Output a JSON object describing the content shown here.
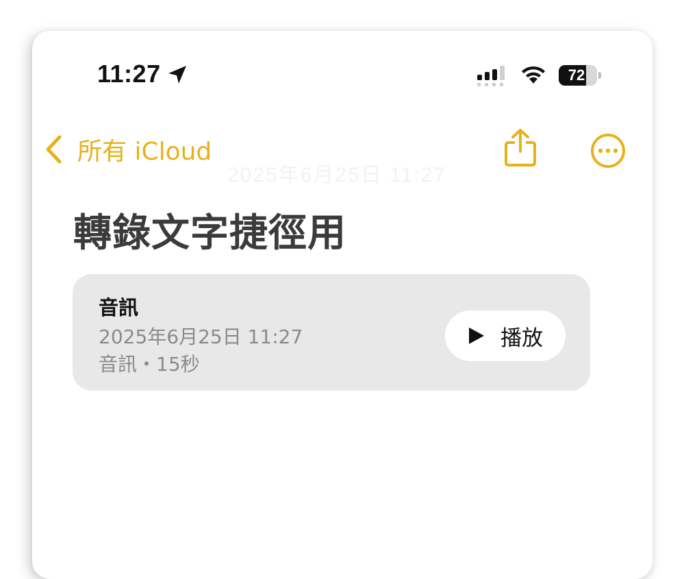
{
  "status_bar": {
    "time": "11:27",
    "battery_level": "72",
    "battery_fraction": 0.72,
    "location_icon": "location-arrow-icon",
    "signal_icon": "cellular-signal-icon",
    "wifi_icon": "wifi-icon"
  },
  "nav": {
    "back_label": "所有 iCloud",
    "back_icon": "chevron-left-icon",
    "share_icon": "share-icon",
    "more_icon": "ellipsis-circle-icon",
    "ghost_title": "2025年6月25日 11:27"
  },
  "note": {
    "title": "轉錄文字捷徑用"
  },
  "audio_attachment": {
    "title": "音訊",
    "date": "2025年6月25日 11:27",
    "meta": "音訊・15秒",
    "play_label": "播放",
    "play_icon": "play-icon"
  },
  "colors": {
    "accent": "#E6B21A",
    "card_background": "#E8E8E8",
    "title_text": "#3B3B3B",
    "secondary_text": "#8A8A8A"
  }
}
